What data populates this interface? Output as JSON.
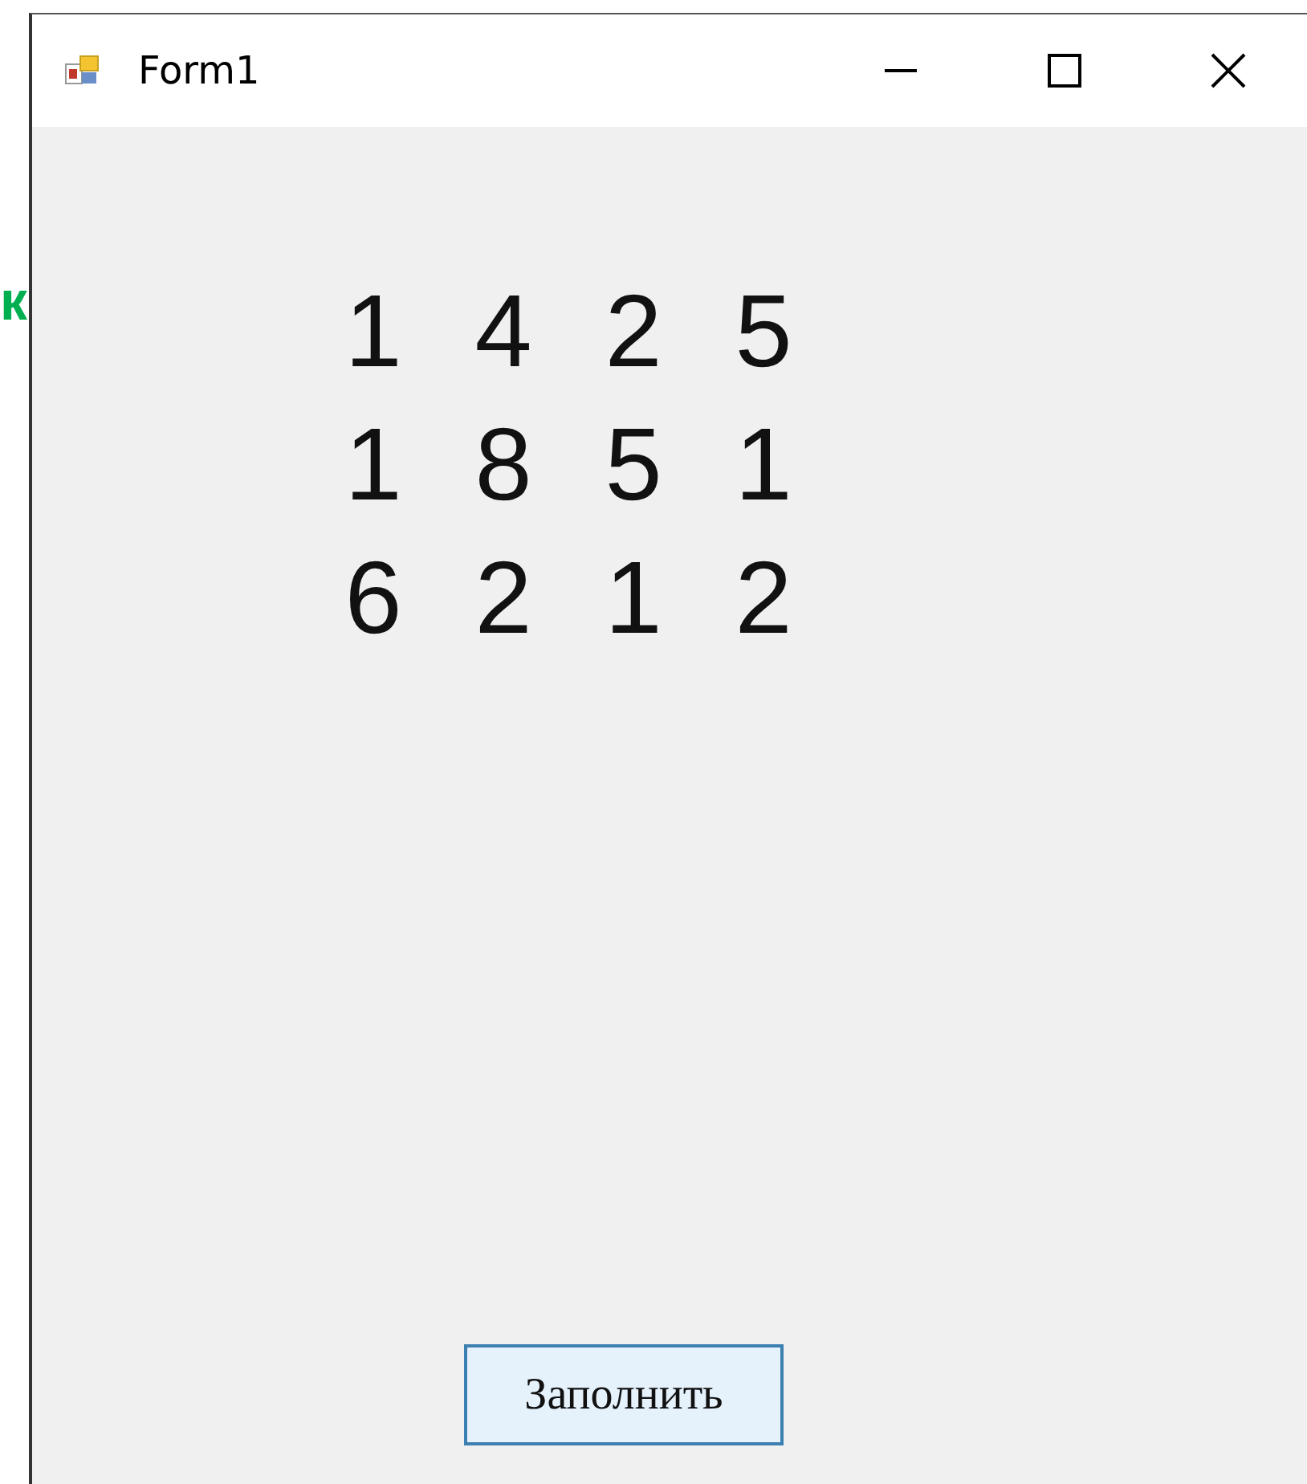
{
  "background_text": "к",
  "window": {
    "title": "Form1"
  },
  "matrix": [
    [
      "1",
      "4",
      "2",
      "5"
    ],
    [
      "1",
      "8",
      "5",
      "1"
    ],
    [
      "6",
      "2",
      "1",
      "2"
    ]
  ],
  "buttons": [
    "Заполнить"
  ]
}
